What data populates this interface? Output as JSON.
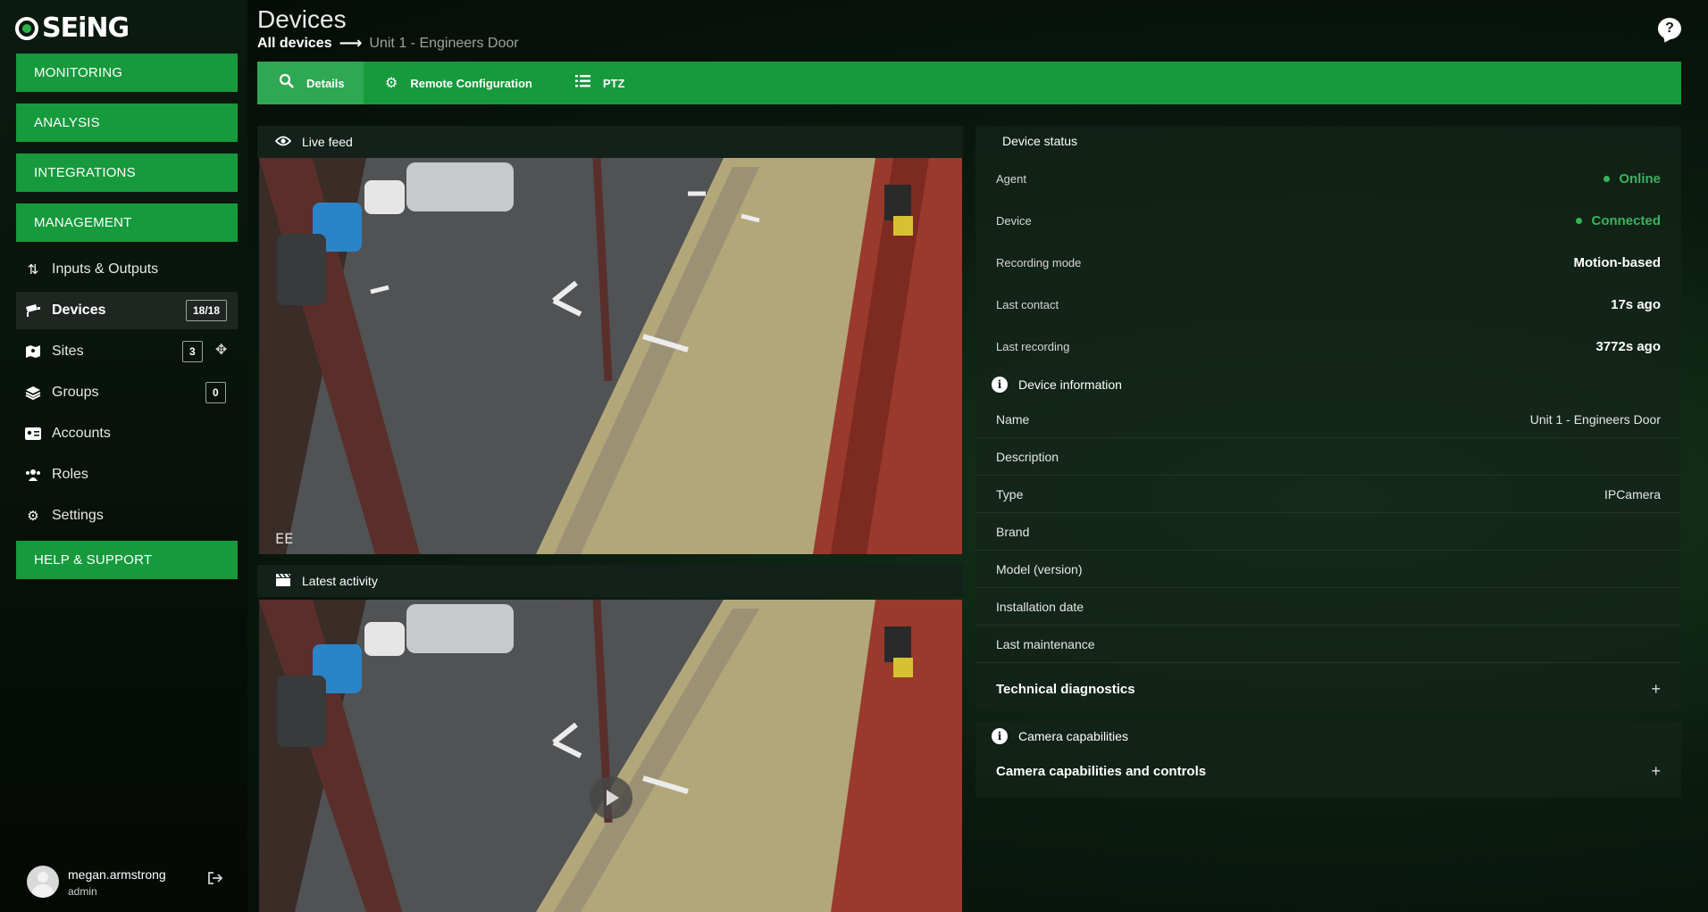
{
  "brand": {
    "name": "SEiNG"
  },
  "sidebar": {
    "primary": [
      {
        "label": "MONITORING"
      },
      {
        "label": "ANALYSIS"
      },
      {
        "label": "INTEGRATIONS"
      },
      {
        "label": "MANAGEMENT"
      }
    ],
    "items": [
      {
        "label": "Inputs & Outputs",
        "icon": "arrows-updown-icon"
      },
      {
        "label": "Devices",
        "icon": "camera-icon",
        "badge": "18/18",
        "active": true
      },
      {
        "label": "Sites",
        "icon": "map-icon",
        "badge": "3"
      },
      {
        "label": "Groups",
        "icon": "layers-icon",
        "badge": "0"
      },
      {
        "label": "Accounts",
        "icon": "id-card-icon"
      },
      {
        "label": "Roles",
        "icon": "users-icon"
      },
      {
        "label": "Settings",
        "icon": "gear-icon"
      }
    ],
    "help": {
      "label": "HELP & SUPPORT"
    }
  },
  "user": {
    "name": "megan.armstrong",
    "role": "admin"
  },
  "header": {
    "title": "Devices",
    "breadcrumb_root": "All devices",
    "breadcrumb_current": "Unit 1 - Engineers Door"
  },
  "tabs": [
    {
      "label": "Details",
      "icon": "search-icon",
      "active": true
    },
    {
      "label": "Remote Configuration",
      "icon": "gear-icon"
    },
    {
      "label": "PTZ",
      "icon": "list-icon"
    }
  ],
  "live_feed": {
    "title": "Live feed",
    "overlay_text": "EE"
  },
  "latest_activity": {
    "title": "Latest activity"
  },
  "device_status": {
    "title": "Device status",
    "rows": [
      {
        "label": "Agent",
        "value": "Online"
      },
      {
        "label": "Device",
        "value": "Connected"
      },
      {
        "label": "Recording mode",
        "value": "Motion-based"
      },
      {
        "label": "Last contact",
        "value": "17s ago"
      },
      {
        "label": "Last recording",
        "value": "3772s ago"
      }
    ]
  },
  "device_info": {
    "title": "Device information",
    "rows": [
      {
        "label": "Name",
        "value": "Unit 1 - Engineers Door"
      },
      {
        "label": "Description",
        "value": ""
      },
      {
        "label": "Type",
        "value": "IPCamera"
      },
      {
        "label": "Brand",
        "value": ""
      },
      {
        "label": "Model (version)",
        "value": ""
      },
      {
        "label": "Installation date",
        "value": ""
      },
      {
        "label": "Last maintenance",
        "value": ""
      }
    ],
    "diagnostics": "Technical diagnostics"
  },
  "capabilities": {
    "title": "Camera capabilities",
    "expander": "Camera capabilities and controls"
  },
  "colors": {
    "accent": "#169a3c",
    "status_ok": "#35b55a"
  }
}
